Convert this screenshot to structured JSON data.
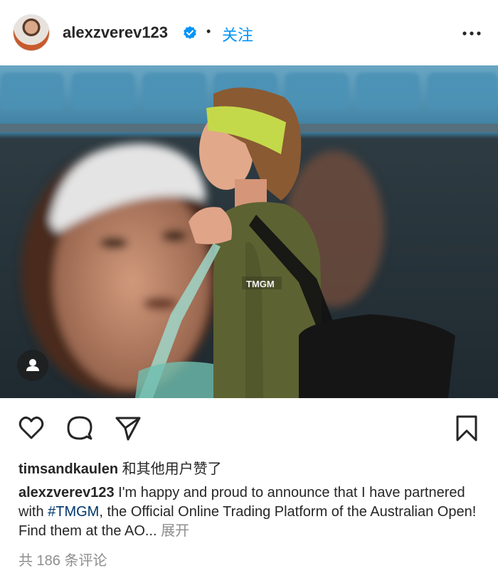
{
  "post": {
    "username": "alexzverev123",
    "follow_label": "关注",
    "separator": "•",
    "likes": {
      "user": "timsandkaulen",
      "suffix": " 和其他用户赞了"
    },
    "caption": {
      "author": "alexzverev123",
      "text_before": " I'm happy and proud to announce that I have partnered with ",
      "hashtag": "#TMGM",
      "text_after": ", the Official Online Trading Platform of the Australian Open! Find them at the AO...",
      "expand_label": " 展开"
    },
    "comments_label": "共 186 条评论",
    "photo": {
      "shirt_logo": "TMGM"
    }
  },
  "icons": {
    "verified": "verified-badge-icon",
    "more": "more-options-icon",
    "like": "heart-icon",
    "comment": "comment-icon",
    "share": "share-icon",
    "save": "bookmark-icon",
    "tag": "person-tag-icon"
  },
  "colors": {
    "link_blue": "#0095f6",
    "hashtag_blue": "#00376b",
    "text": "#262626",
    "secondary": "#8e8e8e"
  }
}
